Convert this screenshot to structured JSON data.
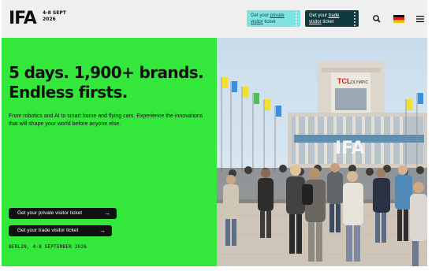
{
  "header": {
    "logo": "IFA",
    "date_line1": "4-8 SEPT",
    "date_line2": "2026",
    "private_ticket_line1_a": "Get your ",
    "private_ticket_line1_b": "private",
    "private_ticket_line2_a": "visitor",
    "private_ticket_line2_b": " ticket",
    "trade_ticket_line1_a": "Get your ",
    "trade_ticket_line1_b": "trade",
    "trade_ticket_line2_a": "visitor",
    "trade_ticket_line2_b": " ticket",
    "icons": [
      "search-icon",
      "german-flag-icon",
      "menu-icon"
    ]
  },
  "hero": {
    "headline_line1": "5 days. 1,900+ brands.",
    "headline_line2": "Endless firsts.",
    "description": "From robotics and AI to smart home and flying cars. Experience the innovations that will shape your world before anyone else.",
    "private_button": "Get your private visitor ticket",
    "trade_button": "Get your trade visitor ticket",
    "arrow": "→",
    "location_date": "BERLIN, 4-8 SEPTEMBER 2026",
    "accent_color": "#33e83a"
  },
  "photo": {
    "building_sign": "TCL",
    "building_sign_sub": "OLYMPIC",
    "entrance_sign": "IFA"
  }
}
